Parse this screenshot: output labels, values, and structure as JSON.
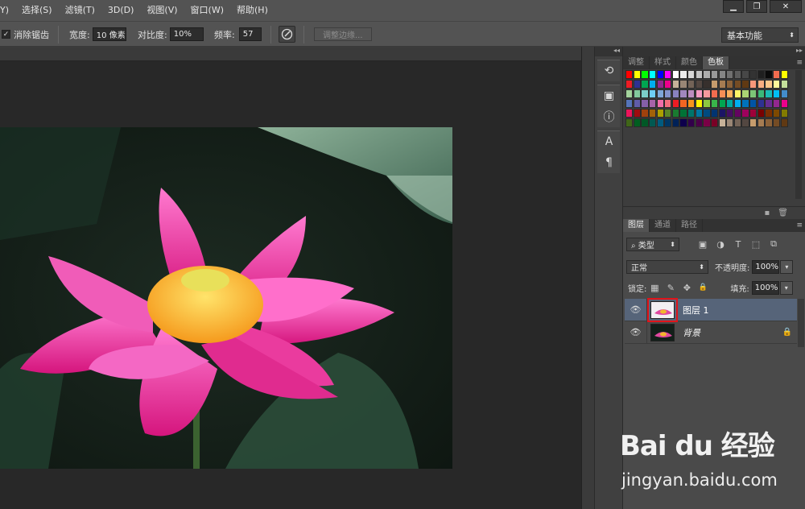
{
  "menubar": {
    "items": [
      "Y)",
      "选择(S)",
      "滤镜(T)",
      "3D(D)",
      "视图(V)",
      "窗口(W)",
      "帮助(H)"
    ],
    "window_buttons": [
      "▁",
      "❐",
      "✕"
    ]
  },
  "options": {
    "antialias_label": "消除锯齿",
    "antialias_checked": "✓",
    "width_label": "宽度:",
    "width_value": "10 像素",
    "contrast_label": "对比度:",
    "contrast_value": "10%",
    "frequency_label": "频率:",
    "frequency_value": "57",
    "refine_edge_label": "调整边缘...",
    "workspace_label": "基本功能"
  },
  "dock": {
    "collapse": "◂◂",
    "icons": [
      "history-icon",
      "3d-cube-icon",
      "info-icon",
      "character-icon",
      "paragraph-icon"
    ],
    "glyphs": [
      "⟲",
      "▣",
      "ⓘ",
      "A",
      "¶"
    ]
  },
  "swatch_panel": {
    "collapse": "▸▸",
    "tabs": [
      "调整",
      "样式",
      "颜色",
      "色板"
    ],
    "active_tab": 3,
    "menu_icon": "≡",
    "colors": [
      [
        "#ff0000",
        "#ffff00",
        "#00ff00",
        "#00ffff",
        "#0000ff",
        "#ff00ff",
        "#ffffff",
        "#ebebeb",
        "#d6d6d6",
        "#c2c2c2",
        "#adadad",
        "#999999",
        "#858585",
        "#707070",
        "#5c5c5c",
        "#474747",
        "#333333",
        "#1f1f1f",
        "#0a0a0a",
        "#f26c4f",
        "#ffff00"
      ],
      [
        "#ed1c24",
        "#2e3192",
        "#00a651",
        "#00aeef",
        "#92278f",
        "#ec008c",
        "#c7b299",
        "#998675",
        "#736357",
        "#534741",
        "#37302d",
        "#c69c6d",
        "#a67c52",
        "#8c6239",
        "#754c24",
        "#603913",
        "#f7977a",
        "#f9ad81",
        "#fdc68a",
        "#fff79a",
        "#c4df9b"
      ],
      [
        "#a3d39c",
        "#82ca9d",
        "#7bcdc8",
        "#6ecff6",
        "#7ea7d8",
        "#8493ca",
        "#8882be",
        "#a187be",
        "#bc8dbf",
        "#f49ac2",
        "#f6989d",
        "#f26c4f",
        "#f68e56",
        "#fbaf5d",
        "#fff467",
        "#acd373",
        "#7cc576",
        "#3bb878",
        "#1abbb4",
        "#00bff3",
        "#438ccb"
      ],
      [
        "#5574b9",
        "#605ca8",
        "#855fa8",
        "#a763a8",
        "#f06eaa",
        "#f26d7d",
        "#ed1c24",
        "#f26522",
        "#f7941d",
        "#fff200",
        "#8dc73f",
        "#39b54a",
        "#00a651",
        "#00a99d",
        "#00aeef",
        "#0072bc",
        "#0054a6",
        "#2e3192",
        "#662d91",
        "#92278f",
        "#ec008c"
      ],
      [
        "#ed145b",
        "#9e0b0f",
        "#a0410d",
        "#a36209",
        "#aba000",
        "#598527",
        "#1a7b30",
        "#007236",
        "#00746b",
        "#0076a3",
        "#004b80",
        "#003471",
        "#1b1464",
        "#440e62",
        "#630460",
        "#9e005d",
        "#9e0039",
        "#790000",
        "#7b2e00",
        "#7d4900",
        "#827b00"
      ],
      [
        "#406618",
        "#005e20",
        "#005826",
        "#005952",
        "#005b7f",
        "#003663",
        "#002157",
        "#0d004c",
        "#32004b",
        "#4b0049",
        "#7b0046",
        "#7a0026",
        "#c7b299",
        "#998675",
        "#736357",
        "#534741",
        "#c69c6d",
        "#a67c52",
        "#8c6239",
        "#754c24",
        "#603913"
      ]
    ],
    "footer_icons": [
      "new-swatch-icon",
      "trash-icon"
    ],
    "footer_glyphs": [
      "▪",
      "🗑"
    ]
  },
  "layers_panel": {
    "tabs": [
      "图层",
      "通道",
      "路径"
    ],
    "active_tab": 0,
    "menu_icon": "≡",
    "filter_label": "⌕ 类型",
    "filter_icons": [
      "▣",
      "◑",
      "T",
      "⬚",
      "⧉"
    ],
    "blend_mode": "正常",
    "opacity_label": "不透明度:",
    "opacity_value": "100%",
    "lock_label": "锁定:",
    "lock_icons": [
      "▦",
      "✎",
      "✥",
      "🔒"
    ],
    "fill_label": "填充:",
    "fill_value": "100%",
    "layers": [
      {
        "name": "图层 1",
        "visible": "👁",
        "selected": true,
        "locked": ""
      },
      {
        "name": "背景",
        "visible": "👁",
        "selected": false,
        "locked": "🔒"
      }
    ]
  },
  "watermark": {
    "brand": "Bai  du 经验",
    "url": "jingyan.baidu.com"
  }
}
